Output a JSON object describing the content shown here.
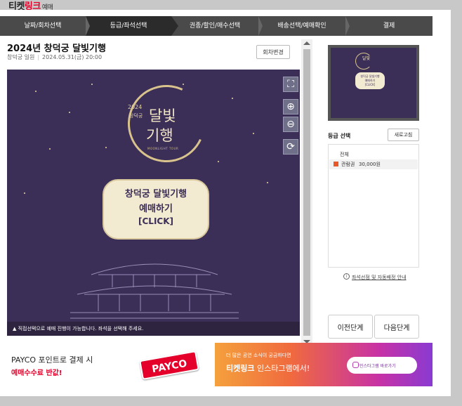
{
  "brand": {
    "name_black": "티켓",
    "name_red": "링크",
    "sub": "예매"
  },
  "steps": [
    {
      "label": "날짜/회차선택",
      "active": false
    },
    {
      "label": "등급/좌석선택",
      "active": true
    },
    {
      "label": "권종/할인/매수선택",
      "active": false
    },
    {
      "label": "배송선택/예매확인",
      "active": false
    },
    {
      "label": "결제",
      "active": false
    }
  ],
  "event": {
    "title": "2024년 창덕궁 달빛기행",
    "venue": "창덕궁 일원",
    "datetime": "2024.05.31(금) 20:00",
    "change_button": "회차변경"
  },
  "seatmap": {
    "poster_year": "2024",
    "poster_palace": "창덕궁",
    "poster_title_1": "달빛",
    "poster_title_2": "기행",
    "poster_en": "MOONLIGHT TOUR",
    "cta_line1": "창덕궁 달빛기행",
    "cta_line2": "예매하기",
    "cta_line3": "[CLICK]",
    "notice": "직접선택으로 예매 진행이 가능합니다. 좌석을 선택해 주세요."
  },
  "tools": {
    "fit_icon": "fit-screen-icon",
    "zoom_in_icon": "zoom-in-icon",
    "zoom_out_icon": "zoom-out-icon",
    "reset_icon": "refresh-icon"
  },
  "grade": {
    "label": "등급 선택",
    "refresh_button": "새로고침",
    "all_label": "전체",
    "items": [
      {
        "name": "관람권",
        "price": "30,000원",
        "color": "#e8572a"
      }
    ],
    "info_link": "좌석선점 및 자동배정 안내"
  },
  "buttons": {
    "prev": "이전단계",
    "next": "다음단계"
  },
  "banners": {
    "payco_line1": "PAYCO 포인트로 결제 시",
    "payco_line2": "예매수수료 반값!",
    "payco_logo": "PAYCO",
    "insta_line1": "더 많은 공연 소식이 궁금하다면",
    "insta_brand": "티켓링크",
    "insta_line2_rest": " 인스타그램에서!",
    "insta_button": "인스타그램 바로가기"
  }
}
